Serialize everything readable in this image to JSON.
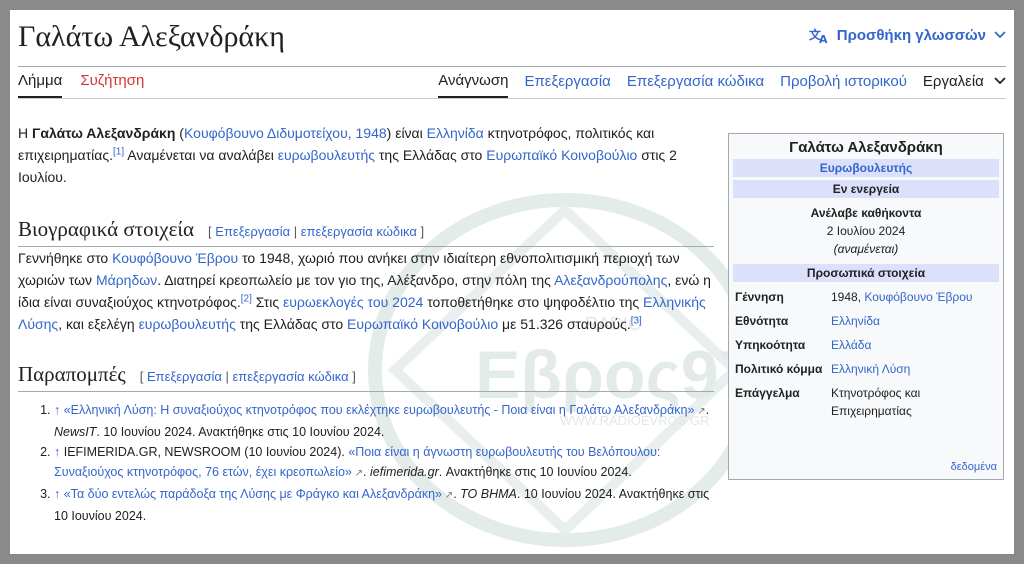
{
  "header": {
    "title": "Γαλάτω Αλεξανδράκη",
    "add_languages": "Προσθήκη γλωσσών"
  },
  "tabs": {
    "article": "Λήμμα",
    "talk": "Συζήτηση",
    "read": "Ανάγνωση",
    "edit": "Επεξεργασία",
    "edit_source": "Επεξεργασία κώδικα",
    "history": "Προβολή ιστορικού",
    "tools": "Εργαλεία"
  },
  "intro": {
    "p1": "Η ",
    "name": "Γαλάτω Αλεξανδράκη",
    "p2": " (",
    "place_year": "Κουφόβουνο Διδυμοτείχου, 1948",
    "p3": ") είναι ",
    "nationality": "Ελληνίδα",
    "p4": " κτηνοτρόφος, πολιτικός και επιχειρηματίας.",
    "ref1": "[1]",
    "p5": " Αναμένεται να αναλάβει ",
    "mep": "ευρωβουλευτής",
    "p6": " της Ελλάδας στο ",
    "parliament": "Ευρωπαϊκό Κοινοβούλιο",
    "p7": " στις 2 Ιουλίου."
  },
  "bio": {
    "heading": "Βιογραφικά στοιχεία",
    "edit": "Επεξεργασία",
    "edit_source": "επεξεργασία κώδικα",
    "t1": "Γεννήθηκε στο ",
    "l1": "Κουφόβουνο Έβρου",
    "t2": " το 1948, χωριό που ανήκει στην ιδιαίτερη εθνοπολιτισμική περιοχή των χωριών των ",
    "l2": "Μάρηδων",
    "t3": ". Διατηρεί κρεοπωλείο με τον γιο της, Αλέξανδρο, στην πόλη της ",
    "l3": "Αλεξανδρούπολης",
    "t4": ", ενώ η ίδια είναι συναξιούχος κτηνοτρόφος.",
    "ref2": "[2]",
    "t5": " Στις ",
    "l4": "ευρωεκλογές του 2024",
    "t6": " τοποθετήθηκε στο ψηφοδέλτιο της ",
    "l5": "Ελληνικής Λύσης",
    "t7": ", και εξελέγη ",
    "l6": "ευρωβουλευτής",
    "t8": " της Ελλάδας στο ",
    "l7": "Ευρωπαϊκό Κοινοβούλιο",
    "t9": " με 51.326 σταυρούς.",
    "ref3": "[3]"
  },
  "refs": {
    "heading": "Παραπομπές",
    "edit": "Επεξεργασία",
    "edit_source": "επεξεργασία κώδικα",
    "r1_link": "«Ελληνική Λύση: Η συναξιούχος κτηνοτρόφος που εκλέχτηκε ευρωβουλευτής - Ποια είναι η Γαλάτω Αλεξανδράκη»",
    "r1_source": "NewsIT",
    "r1_rest": ". 10 Ιουνίου 2024. Ανακτήθηκε στις 10 Ιουνίου 2024.",
    "r2_authors": "IEFIMERIDA.GR, NEWSROOM (10 Ιουνίου 2024). ",
    "r2_link": "«Ποια είναι η άγνωστη ευρωβουλευτής του Βελόπουλου: Συναξιούχος κτηνοτρόφος, 76 ετών, έχει κρεοπωλείο»",
    "r2_source": "iefimerida.gr",
    "r2_rest": ". Ανακτήθηκε στις 10 Ιουνίου 2024.",
    "r3_link": "«Τα δύο εντελώς παράδοξα της Λύσης με Φράγκο και Αλεξανδράκη»",
    "r3_source": "ΤΟ ΒΗΜΑ",
    "r3_rest": ". 10 Ιουνίου 2024. Ανακτήθηκε στις 10 Ιουνίου 2024."
  },
  "infobox": {
    "title": "Γαλάτω Αλεξανδράκη",
    "role": "Ευρωβουλευτής",
    "status": "Εν ενεργεία",
    "took_office_label": "Ανέλαβε καθήκοντα",
    "took_office_date": "2 Ιουλίου 2024",
    "took_office_note": "(αναμένεται)",
    "personal": "Προσωπικά στοιχεία",
    "birth_label": "Γέννηση",
    "birth_year": "1948, ",
    "birth_place": "Κουφόβουνο Έβρου",
    "ethnicity_label": "Εθνότητα",
    "ethnicity": "Ελληνίδα",
    "citizenship_label": "Υπηκοότητα",
    "citizenship": "Ελλάδα",
    "party_label": "Πολιτικό κόμμα",
    "party": "Ελληνική Λύση",
    "occupation_label": "Επάγγελμα",
    "occupation": "Κτηνοτρόφος και Επιχειρηματίας",
    "data_link": "δεδομένα"
  },
  "watermark": {
    "brand": "Εβρος97.1",
    "url": "WWW.RADIOEVROS.GR",
    "small": "RADIO"
  },
  "colors": {
    "link": "#3366cc",
    "talk_red": "#d73333",
    "infobox_band": "#dde0fb",
    "border": "#a2a9b1"
  }
}
